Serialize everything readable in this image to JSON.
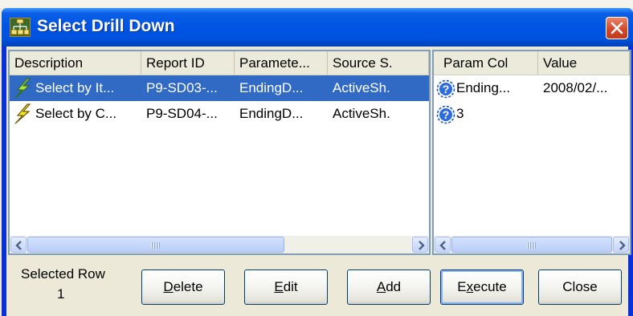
{
  "window": {
    "title": "Select Drill Down",
    "close_icon": "close-icon"
  },
  "list": {
    "columns": [
      "Description",
      "Report ID",
      "Paramete...",
      "Source S."
    ],
    "rows": [
      {
        "icon": "lightning-icon",
        "cells": [
          "Select by It...",
          "P9-SD03-...",
          "EndingD...",
          "ActiveSh."
        ],
        "selected": true
      },
      {
        "icon": "lightning-icon",
        "cells": [
          "Select by C...",
          "P9-SD04-...",
          "EndingD...",
          "ActiveSh."
        ],
        "selected": false
      }
    ]
  },
  "params": {
    "columns": [
      "Param Col",
      "Value"
    ],
    "rows": [
      {
        "icon": "question-icon",
        "cells": [
          "Ending...",
          "2008/02/..."
        ]
      },
      {
        "icon": "question-icon",
        "cells": [
          "3",
          ""
        ]
      }
    ]
  },
  "status": {
    "label": "Selected Row",
    "value": "1"
  },
  "buttons": {
    "delete": {
      "pre": "",
      "key": "D",
      "post": "elete"
    },
    "edit": {
      "pre": "",
      "key": "E",
      "post": "dit"
    },
    "add": {
      "pre": "",
      "key": "A",
      "post": "dd"
    },
    "execute": {
      "pre": "E",
      "key": "x",
      "post": "ecute"
    },
    "close": "Close"
  },
  "colors": {
    "titlebar": "#0054e3",
    "selection": "#316ac5",
    "close_button": "#d5492a",
    "dialog_bg": "#ece9d8"
  }
}
